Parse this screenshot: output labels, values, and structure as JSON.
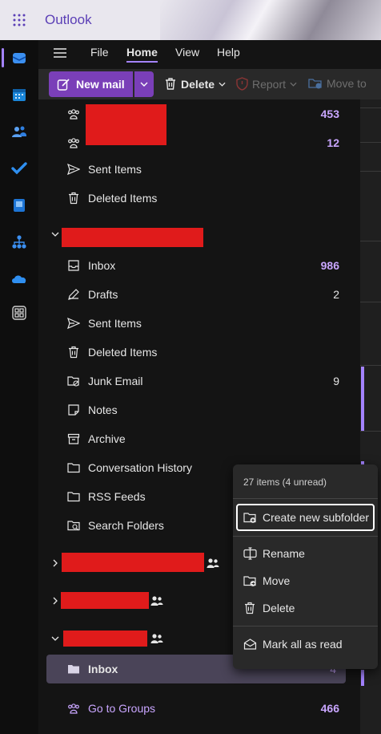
{
  "app": {
    "name": "Outlook"
  },
  "menu_tabs": [
    "File",
    "Home",
    "View",
    "Help"
  ],
  "active_tab": "Home",
  "ribbon": {
    "new_mail": "New mail",
    "delete": "Delete",
    "report": "Report",
    "move_to": "Move to"
  },
  "folders": {
    "group1": [
      {
        "label": "",
        "count": "453"
      },
      {
        "label": "",
        "count": "12"
      },
      {
        "label": "Sent Items",
        "count": ""
      },
      {
        "label": "Deleted Items",
        "count": ""
      }
    ],
    "account2": [
      {
        "label": "Inbox",
        "count": "986"
      },
      {
        "label": "Drafts",
        "count": "2"
      },
      {
        "label": "Sent Items",
        "count": ""
      },
      {
        "label": "Deleted Items",
        "count": ""
      },
      {
        "label": "Junk Email",
        "count": "9"
      },
      {
        "label": "Notes",
        "count": ""
      },
      {
        "label": "Archive",
        "count": ""
      },
      {
        "label": "Conversation History",
        "count": ""
      },
      {
        "label": "RSS Feeds",
        "count": ""
      },
      {
        "label": "Search Folders",
        "count": ""
      }
    ],
    "group_inbox": {
      "label": "Inbox",
      "count": "4"
    },
    "go_to_groups": {
      "label": "Go to Groups",
      "count": "466"
    }
  },
  "context_menu": {
    "info": "27 items (4 unread)",
    "items": [
      "Create new subfolder",
      "Rename",
      "Move",
      "Delete",
      "Mark all as read"
    ]
  },
  "colors": {
    "accent": "#a483ff",
    "primary_button": "#7a3fb8",
    "unread_count": "#c9a6ff",
    "redaction": "#e01b1b"
  }
}
